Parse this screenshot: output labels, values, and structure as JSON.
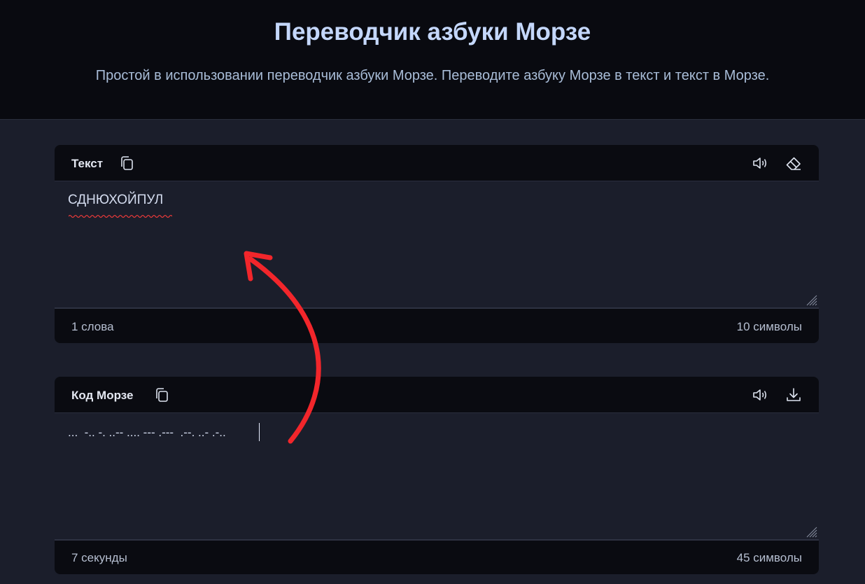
{
  "header": {
    "title": "Переводчик азбуки Морзе",
    "subtitle": "Простой в использовании переводчик азбуки Морзе. Переводите азбуку Морзе в текст и текст в Морзе."
  },
  "text_panel": {
    "title": "Текст",
    "value": "СДНЮХОЙПУЛ",
    "words": "1 слова",
    "chars": "10 символы",
    "icons": [
      "copy-icon",
      "speaker-icon",
      "eraser-icon"
    ]
  },
  "morse_panel": {
    "title": "Код Морзе",
    "value": "...  -.. -. ..-- .... --- .---  .--. ..- .-..",
    "duration": "7 секунды",
    "chars": "45 символы",
    "icons": [
      "copy-icon",
      "speaker-icon",
      "download-icon"
    ]
  },
  "colors": {
    "page_bg": "#1b1e2b",
    "header_bg": "#090a10",
    "title": "#c4d7fb",
    "annotation_arrow": "#f2262b"
  }
}
